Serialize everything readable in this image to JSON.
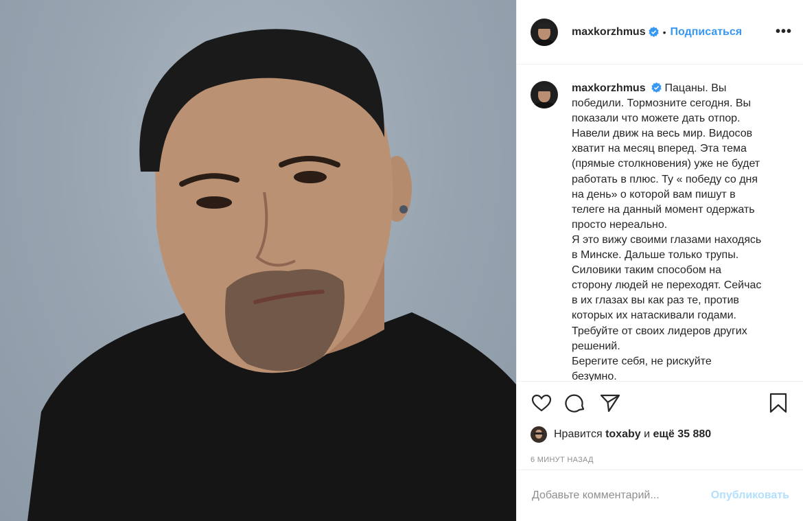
{
  "post": {
    "username": "maxkorzhmus",
    "header_separator": "•",
    "follow_label": "Подписаться",
    "more_label": "•••",
    "caption_paragraphs": [
      "Пацаны. Вы\nпобедили. Тормозните сегодня. Вы\nпоказали что можете дать отпор.\nНавели движ на весь мир. Видосов\nхватит на месяц вперед. Эта тема\n(прямые столкновения) уже не будет\nработать в плюс. Ту « победу со дня\nна день» о которой вам пишут в\nтелеге на данный момент одержать\nпросто нереально.",
      "Я это вижу своими глазами находясь\nв Минске. Дальше только трупы.\nСиловики таким способом на\nсторону людей не переходят. Сейчас\nв их глазах вы как раз те, против\nкоторых их натаскивали годами.\nТребуйте от своих лидеров других\nрешений.",
      "Берегите себя, не рискуйте\nбезумно."
    ],
    "likes": {
      "prefix": "Нравится",
      "user": "toxaby",
      "and": "и",
      "others": "ещё 35 880"
    },
    "timestamp": "6 МИНУТ НАЗАД",
    "comment_placeholder": "Добавьте комментарий...",
    "publish_label": "Опубликовать"
  },
  "icons": [
    "verified-badge-icon",
    "heart-icon",
    "comment-icon",
    "share-icon",
    "bookmark-icon"
  ],
  "colors": {
    "accent": "#3897f0",
    "publish_disabled": "#b2dffc",
    "muted": "#8e8e8e",
    "photo_background": "#97a4b0"
  }
}
